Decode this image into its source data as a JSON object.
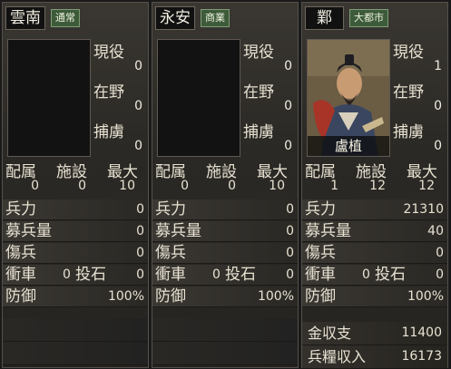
{
  "cities": [
    {
      "name": "雲南",
      "type": "通常",
      "portrait": false,
      "officer": "",
      "stats": {
        "active": "0",
        "wild": "0",
        "captives": "0"
      },
      "counts": {
        "assigned": "0",
        "facilities": "0",
        "max": "10"
      },
      "rows": {
        "troops": "0",
        "recruits": "0",
        "wounded": "0",
        "rams": "0",
        "catapults": "0",
        "defense": "100%"
      },
      "income": null
    },
    {
      "name": "永安",
      "type": "商業",
      "portrait": false,
      "officer": "",
      "stats": {
        "active": "0",
        "wild": "0",
        "captives": "0"
      },
      "counts": {
        "assigned": "0",
        "facilities": "0",
        "max": "10"
      },
      "rows": {
        "troops": "0",
        "recruits": "0",
        "wounded": "0",
        "rams": "0",
        "catapults": "0",
        "defense": "100%"
      },
      "income": null
    },
    {
      "name": "鄴",
      "type": "大都市",
      "portrait": true,
      "officer": "盧植",
      "stats": {
        "active": "1",
        "wild": "0",
        "captives": "0"
      },
      "counts": {
        "assigned": "1",
        "facilities": "12",
        "max": "12"
      },
      "rows": {
        "troops": "21310",
        "recruits": "40",
        "wounded": "0",
        "rams": "0",
        "catapults": "0",
        "defense": "100%"
      },
      "income": {
        "gold": "11400",
        "food": "16173"
      }
    }
  ],
  "labels": {
    "active": "現役",
    "wild": "在野",
    "captives": "捕虜",
    "assigned": "配属",
    "facilities": "施設",
    "max": "最大",
    "troops": "兵力",
    "recruits": "募兵量",
    "wounded": "傷兵",
    "rams": "衝車",
    "catapults": "投石",
    "defense": "防御",
    "gold": "金収支",
    "food": "兵糧収入"
  }
}
